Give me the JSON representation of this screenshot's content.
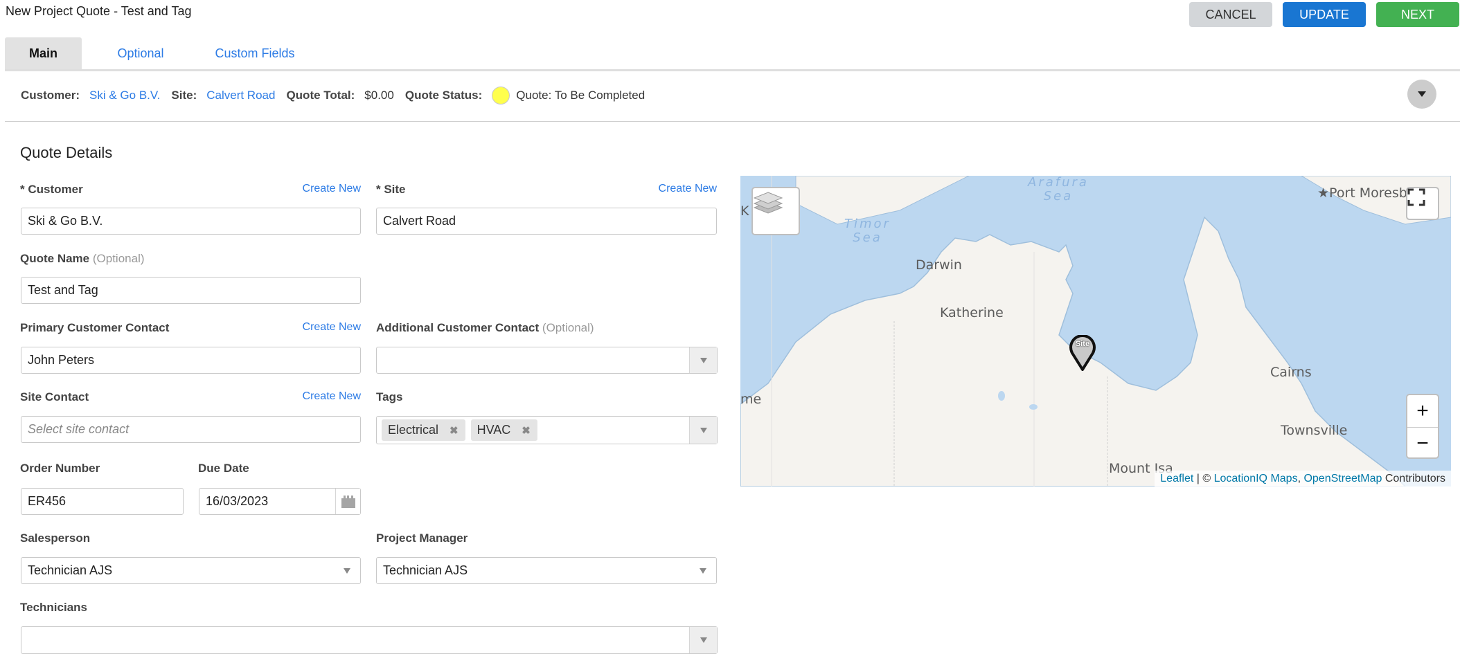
{
  "header": {
    "title": "New Project Quote - Test and Tag",
    "buttons": {
      "cancel": "CANCEL",
      "update": "UPDATE",
      "next": "NEXT"
    }
  },
  "tabs": [
    {
      "label": "Main",
      "active": true
    },
    {
      "label": "Optional",
      "active": false
    },
    {
      "label": "Custom Fields",
      "active": false
    }
  ],
  "infobar": {
    "customer_label": "Customer:",
    "customer_value": "Ski & Go B.V.",
    "site_label": "Site:",
    "site_value": "Calvert Road",
    "total_label": "Quote Total:",
    "total_value": "$0.00",
    "status_label": "Quote Status:",
    "status_value": "Quote: To Be Completed",
    "status_color": "#ffff4d"
  },
  "section": {
    "title": "Quote Details"
  },
  "form": {
    "create_new": "Create New",
    "optional": "(Optional)",
    "customer": {
      "label": "* Customer",
      "value": "Ski & Go B.V."
    },
    "site": {
      "label": "* Site",
      "value": "Calvert Road"
    },
    "quote_name": {
      "label": "Quote Name",
      "value": "Test and Tag"
    },
    "primary_contact": {
      "label": "Primary Customer Contact",
      "value": "John Peters"
    },
    "additional_contact": {
      "label": "Additional Customer Contact",
      "value": ""
    },
    "site_contact": {
      "label": "Site Contact",
      "placeholder": "Select site contact"
    },
    "tags": {
      "label": "Tags",
      "values": [
        "Electrical",
        "HVAC"
      ],
      "remove_glyph": "✖"
    },
    "order_number": {
      "label": "Order Number",
      "value": "ER456"
    },
    "due_date": {
      "label": "Due Date",
      "value": "16/03/2023"
    },
    "salesperson": {
      "label": "Salesperson",
      "value": "Technician AJS"
    },
    "project_manager": {
      "label": "Project Manager",
      "value": "Technician AJS"
    },
    "technicians": {
      "label": "Technicians",
      "value": ""
    }
  },
  "map": {
    "labels": {
      "darwin": "Darwin",
      "katherine": "Katherine",
      "cairns": "Cairns",
      "townsville": "Townsville",
      "mount_isa": "Mount Isa",
      "port_moresby": "★Port Moresby",
      "broome_partial": "me",
      "kupang_partial": "K",
      "timor_sea": "Timor\nSea",
      "arafura_sea": "Arafura\nSea"
    },
    "marker_label": "Site",
    "zoom_in": "+",
    "zoom_out": "−",
    "attribution": {
      "leaflet": "Leaflet",
      "sep": " | © ",
      "locationiq": "LocationIQ Maps",
      "comma": ", ",
      "osm": "OpenStreetMap",
      "contributors": " Contributors"
    }
  }
}
